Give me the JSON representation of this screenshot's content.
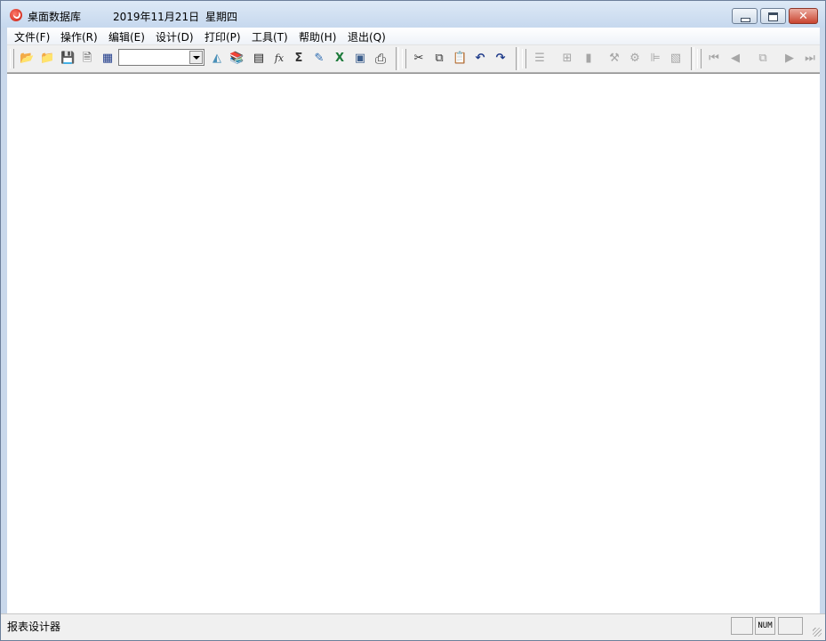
{
  "window": {
    "app_title": "桌面数据库",
    "date": "2019年11月21日",
    "weekday": "星期四",
    "controls": {
      "minimize": "minimize",
      "maximize": "maximize",
      "close": "close"
    }
  },
  "menu": {
    "items": [
      {
        "label": "文件(F)"
      },
      {
        "label": "操作(R)"
      },
      {
        "label": "编辑(E)"
      },
      {
        "label": "设计(D)"
      },
      {
        "label": "打印(P)"
      },
      {
        "label": "工具(T)"
      },
      {
        "label": "帮助(H)"
      },
      {
        "label": "退出(Q)"
      }
    ]
  },
  "toolbar": {
    "combo_value": "",
    "icons": [
      {
        "name": "open-folder-icon",
        "glyph": "📂"
      },
      {
        "name": "open-icon",
        "glyph": "📁"
      },
      {
        "name": "save-icon",
        "glyph": "💾"
      },
      {
        "name": "save-as-icon",
        "glyph": "🗎"
      },
      {
        "name": "table-icon",
        "glyph": "▦"
      },
      {
        "name": "database-icon",
        "glyph": "◭"
      },
      {
        "name": "books-icon",
        "glyph": "📚"
      },
      {
        "name": "grid-icon",
        "glyph": "▤"
      },
      {
        "name": "function-icon",
        "glyph": "fx"
      },
      {
        "name": "sum-icon",
        "glyph": "Σ"
      },
      {
        "name": "edit-icon",
        "glyph": "✎"
      },
      {
        "name": "excel-icon",
        "glyph": "X"
      },
      {
        "name": "archive-icon",
        "glyph": "▣"
      },
      {
        "name": "print-icon",
        "glyph": "⎙"
      },
      {
        "name": "cut-icon",
        "glyph": "✂"
      },
      {
        "name": "copy-icon",
        "glyph": "⧉"
      },
      {
        "name": "paste-icon",
        "glyph": "📋"
      },
      {
        "name": "undo-icon",
        "glyph": "↶"
      },
      {
        "name": "redo-icon",
        "glyph": "↷"
      },
      {
        "name": "list-icon",
        "glyph": "☰"
      },
      {
        "name": "layout-icon",
        "glyph": "⊞"
      },
      {
        "name": "page-icon",
        "glyph": "▮"
      },
      {
        "name": "tools-icon",
        "glyph": "⚒"
      },
      {
        "name": "settings-icon",
        "glyph": "⚙"
      },
      {
        "name": "align-icon",
        "glyph": "⊫"
      },
      {
        "name": "stack-icon",
        "glyph": "▧"
      },
      {
        "name": "first-record-icon",
        "glyph": "⏮"
      },
      {
        "name": "prev-record-icon",
        "glyph": "◀"
      },
      {
        "name": "copy-record-icon",
        "glyph": "⧉"
      },
      {
        "name": "next-record-icon",
        "glyph": "▶"
      },
      {
        "name": "last-record-icon",
        "glyph": "⏭"
      }
    ]
  },
  "status": {
    "text": "报表设计器",
    "num_indicator": "NUM"
  }
}
